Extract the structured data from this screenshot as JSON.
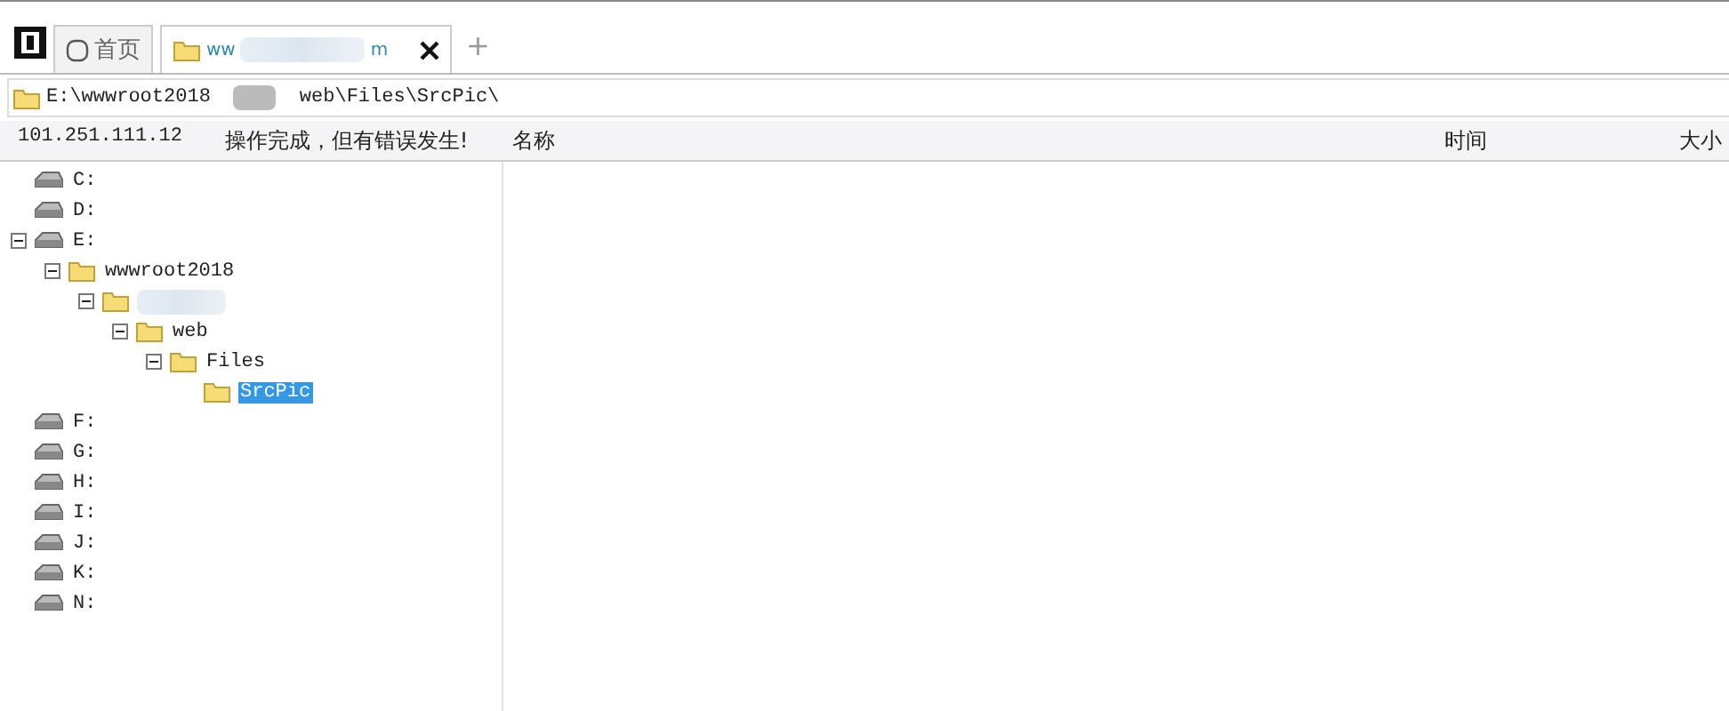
{
  "tabs": [
    {
      "kind": "home",
      "label": "首页",
      "selected": false
    },
    {
      "kind": "folder",
      "label": "ww",
      "label_end": "m",
      "selected": true
    }
  ],
  "new_tab": "+",
  "address": {
    "start": "E:\\wwwroot2018",
    "end": "web\\Files\\SrcPic\\"
  },
  "status": {
    "host": "101.251.111.12",
    "message": "操作完成，但有错误发生!"
  },
  "columns": [
    "名称",
    "时间",
    "大小"
  ],
  "tree": [
    {
      "kind": "drive",
      "label": "C:",
      "selected": false
    },
    {
      "kind": "drive",
      "label": "D:",
      "selected": false
    },
    {
      "kind": "drive",
      "label": "E:",
      "selected": false,
      "expanded": true,
      "children": [
        {
          "kind": "folder",
          "label": "wwwroot2018",
          "selected": false,
          "expanded": true,
          "children": [
            {
              "kind": "folder",
              "selected": false,
              "expanded": true,
              "children": [
                {
                  "kind": "folder",
                  "label": "web",
                  "selected": false,
                  "expanded": true,
                  "children": [
                    {
                      "kind": "folder",
                      "label": "Files",
                      "selected": false,
                      "expanded": true,
                      "children": [
                        {
                          "kind": "folder",
                          "label": "SrcPic",
                          "selected": true
                        }
                      ]
                    }
                  ]
                }
              ]
            }
          ]
        }
      ]
    },
    {
      "kind": "drive",
      "label": "F:",
      "selected": false
    },
    {
      "kind": "drive",
      "label": "G:",
      "selected": false
    },
    {
      "kind": "drive",
      "label": "H:",
      "selected": false
    },
    {
      "kind": "drive",
      "label": "I:",
      "selected": false
    },
    {
      "kind": "drive",
      "label": "J:",
      "selected": false
    },
    {
      "kind": "drive",
      "label": "K:",
      "selected": false
    },
    {
      "kind": "drive",
      "label": "N:",
      "selected": false
    }
  ]
}
